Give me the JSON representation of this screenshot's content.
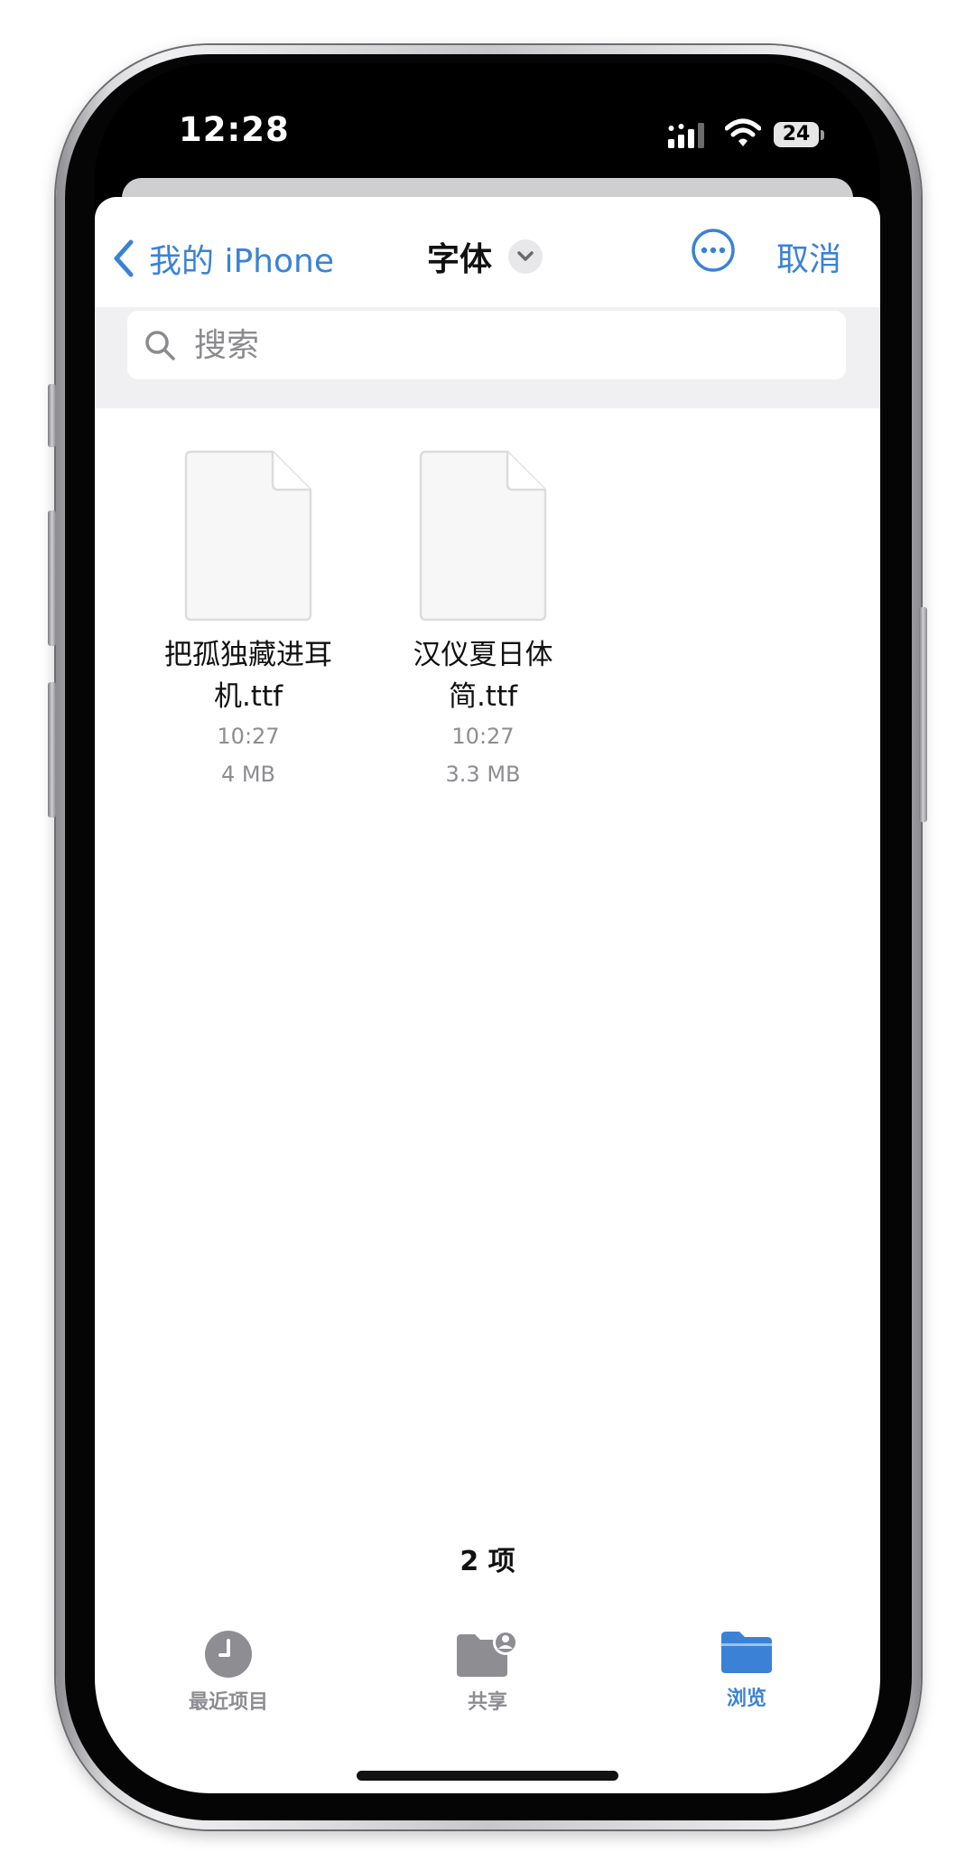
{
  "status_bar": {
    "time": "12:28",
    "battery": "24"
  },
  "nav": {
    "back_label": "我的 iPhone",
    "title": "字体",
    "cancel_label": "取消"
  },
  "search": {
    "placeholder": "搜索"
  },
  "files": [
    {
      "name_line1": "把孤独藏进耳",
      "name_line2": "机.ttf",
      "time": "10:27",
      "size": "4 MB"
    },
    {
      "name_line1": "汉仪夏日体",
      "name_line2": "简.ttf",
      "time": "10:27",
      "size": "3.3 MB"
    }
  ],
  "item_count": "2 项",
  "tabs": [
    {
      "label": "最近项目",
      "icon": "clock-icon"
    },
    {
      "label": "共享",
      "icon": "shared-folder-icon"
    },
    {
      "label": "浏览",
      "icon": "folder-icon",
      "active": true
    }
  ],
  "colors": {
    "accent": "#3b82d6",
    "secondary_text": "#8d8d92"
  }
}
